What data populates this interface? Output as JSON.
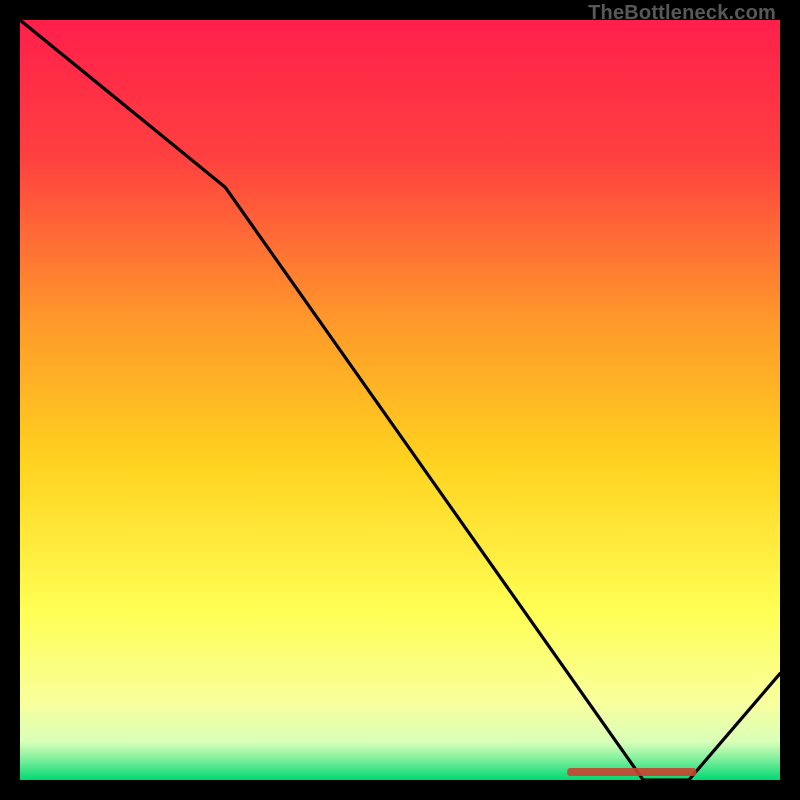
{
  "watermark": "TheBottleneck.com",
  "chart_data": {
    "type": "line",
    "title": "",
    "xlabel": "",
    "ylabel": "",
    "xlim": [
      0,
      100
    ],
    "ylim": [
      0,
      100
    ],
    "x": [
      0,
      27,
      82,
      88,
      100
    ],
    "values": [
      100,
      78,
      0,
      0,
      14
    ],
    "optimum_marker": {
      "x_start": 72,
      "x_end": 89,
      "label": ""
    },
    "background_gradient": [
      "#ff1f4b",
      "#ff7e2d",
      "#ffd21f",
      "#ffff66",
      "#f6ffb0",
      "#00e676"
    ],
    "annotations": []
  }
}
